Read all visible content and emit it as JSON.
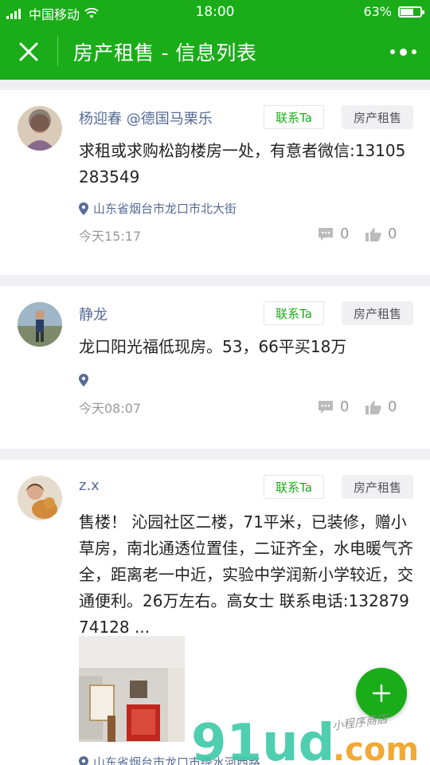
{
  "status_bar": {
    "carrier": "中国移动",
    "time": "18:00",
    "battery": "63%",
    "battery_level": 0.63
  },
  "nav": {
    "title": "房产租售 - 信息列表",
    "close_icon": "close-icon",
    "more_icon": "more-icon"
  },
  "posts": [
    {
      "user": "杨迎春 @德国马栗乐",
      "contact_label": "联系Ta",
      "tag": "房产租售",
      "content": "求租或求购松韵楼房一处，有意者微信:13105283549",
      "location": "山东省烟台市龙口市北大街",
      "time": "今天15:17",
      "comments": "0",
      "likes": "0"
    },
    {
      "user": "静龙",
      "contact_label": "联系Ta",
      "tag": "房产租售",
      "content": "龙口阳光福低现房。53，66平买18万",
      "location": "",
      "time": "今天08:07",
      "comments": "0",
      "likes": "0"
    },
    {
      "user": "z.x",
      "contact_label": "联系Ta",
      "tag": "房产租售",
      "content": "售楼！ 沁园社区二楼，71平米，已装修，赠小草房，南北通透位置佳，二证齐全，水电暖气齐全，距离老一中近，实验中学润新小学较近，交通便利。26万左右。高女士 联系电话:13287974128 ...",
      "location": "山东省烟台市龙口市绛水河西路"
    }
  ],
  "fab_icon": "plus-icon",
  "watermark": {
    "brand": "91ud",
    "suffix": ".com",
    "tagline": "小程序商店"
  },
  "colors": {
    "brand_green": "#1aad19",
    "link_blue": "#576b95"
  }
}
